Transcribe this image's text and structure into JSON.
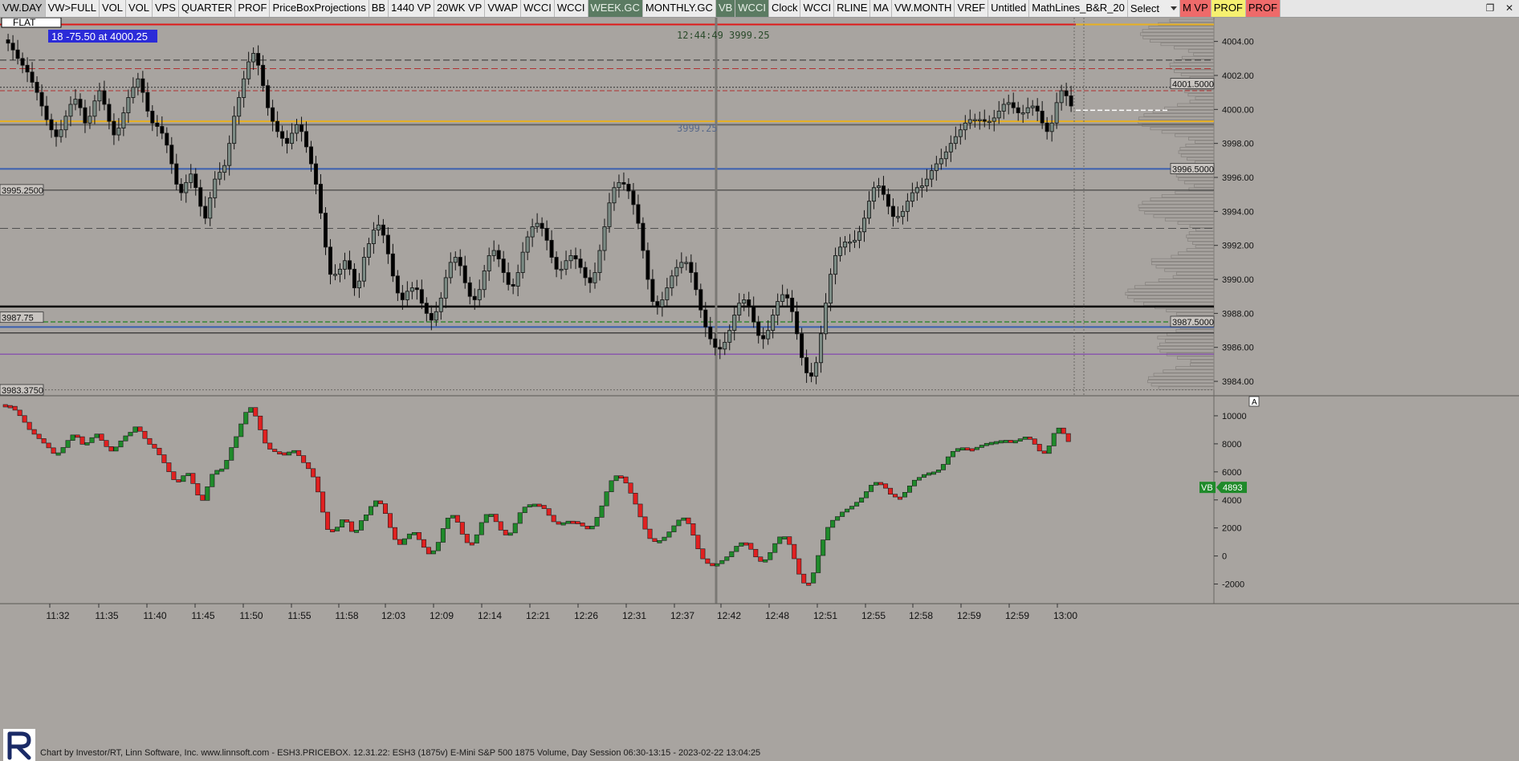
{
  "toolbar": {
    "buttons": [
      {
        "label": "VW.DAY",
        "style": "active"
      },
      {
        "label": "VW>FULL",
        "style": ""
      },
      {
        "label": "VOL",
        "style": ""
      },
      {
        "label": "VOL",
        "style": ""
      },
      {
        "label": "VPS",
        "style": ""
      },
      {
        "label": "QUARTER",
        "style": ""
      },
      {
        "label": "PROF",
        "style": ""
      },
      {
        "label": "PriceBoxProjections",
        "style": ""
      },
      {
        "label": "BB",
        "style": ""
      },
      {
        "label": "1440 VP",
        "style": ""
      },
      {
        "label": "20WK VP",
        "style": ""
      },
      {
        "label": "VWAP",
        "style": ""
      },
      {
        "label": "WCCI",
        "style": ""
      },
      {
        "label": "WCCI",
        "style": ""
      },
      {
        "label": "WEEK.GC",
        "style": "green"
      },
      {
        "label": "MONTHLY.GC",
        "style": ""
      },
      {
        "label": "VB",
        "style": "green"
      },
      {
        "label": "WCCI",
        "style": "green"
      },
      {
        "label": "Clock",
        "style": ""
      },
      {
        "label": "WCCI",
        "style": ""
      },
      {
        "label": "RLINE",
        "style": ""
      },
      {
        "label": "MA",
        "style": ""
      },
      {
        "label": "VW.MONTH",
        "style": ""
      },
      {
        "label": "VREF",
        "style": ""
      },
      {
        "label": "Untitled",
        "style": ""
      },
      {
        "label": "MathLines_B&R_20",
        "style": ""
      },
      {
        "label": "M VP",
        "style": "red"
      },
      {
        "label": "PROF",
        "style": "yellow"
      },
      {
        "label": "PROF",
        "style": "red"
      }
    ],
    "select_label": "Select"
  },
  "window_controls": {
    "restore": "❐",
    "close": "✕"
  },
  "colors": {
    "background": "#a8a4a0",
    "candle_up": "#7b8b84",
    "candle_down": "#000000",
    "bar_up": "#1f8a2a",
    "bar_down": "#e02020",
    "red_line": "#e01818",
    "gold_line": "#e8b020",
    "blue_line": "#3a5fb0",
    "purple_line": "#8040b0",
    "green_dash": "#208020"
  },
  "price_panel": {
    "status_label": "FLAT",
    "position_box": "18  -75.50 at 4000.25",
    "time_price_label": "12:44:49  3999.25",
    "mid_price_label": "3999.25",
    "y_labels": [
      "4004.00",
      "4002.00",
      "4000.00",
      "3998.00",
      "3996.00",
      "3994.00",
      "3992.00",
      "3990.00",
      "3988.00",
      "3986.00",
      "3984.00"
    ],
    "y_values": [
      4004,
      4002,
      4000,
      3998,
      3996,
      3994,
      3992,
      3990,
      3988,
      3986,
      3984
    ],
    "right_tags": [
      {
        "text": "4001.5000",
        "price": 4001.5
      },
      {
        "text": "3996.5000",
        "price": 3996.5
      },
      {
        "text": "3987.5000",
        "price": 3987.5
      }
    ],
    "left_tags": [
      {
        "text": "3995.2500",
        "price": 3995.25
      },
      {
        "text": "3987.75",
        "price": 3987.75
      },
      {
        "text": "3983.3750",
        "price": 3983.375
      }
    ]
  },
  "volume_panel": {
    "y_labels": [
      "10000",
      "8000",
      "6000",
      "4000",
      "2000",
      "0",
      "-2000"
    ],
    "y_values": [
      10000,
      8000,
      6000,
      4000,
      2000,
      0,
      -2000
    ],
    "vb_label": "VB",
    "vb_value": "4893",
    "corner_label": "A"
  },
  "time_axis": [
    "11:32",
    "11:35",
    "11:40",
    "11:45",
    "11:50",
    "11:55",
    "11:58",
    "12:03",
    "12:09",
    "12:14",
    "12:21",
    "12:26",
    "12:31",
    "12:37",
    "12:42",
    "12:48",
    "12:51",
    "12:55",
    "12:58",
    "12:59",
    "12:59",
    "13:00"
  ],
  "footer": "Chart by Investor/RT, Linn Software, Inc. www.linnsoft.com - ESH3.PRICEBOX.  12.31.22: ESH3 (1875v) E-Mini S&P 500 1875 Volume, Day Session 06:30-13:15 - 2023-02-22 13:04:25",
  "chart_data": {
    "type": "candlestick",
    "closes": [
      4003.9,
      4003.5,
      4003.0,
      4002.6,
      4002.2,
      4001.6,
      4001.0,
      4000.2,
      3999.4,
      3998.8,
      3998.4,
      3998.8,
      3999.6,
      4000.3,
      4000.6,
      4000.1,
      3999.2,
      3999.6,
      4000.5,
      4001.1,
      4000.3,
      3999.3,
      3998.5,
      3998.9,
      3999.8,
      4000.7,
      4001.3,
      4001.8,
      4001.0,
      3999.9,
      3999.2,
      3999.0,
      3998.6,
      3997.9,
      3996.8,
      3995.6,
      3995.1,
      3995.7,
      3996.2,
      3995.4,
      3994.3,
      3993.6,
      3994.8,
      3995.9,
      3996.3,
      3996.7,
      3998.0,
      3999.6,
      4000.7,
      4001.8,
      4002.8,
      4003.3,
      4002.6,
      4001.4,
      4000.1,
      3999.3,
      3998.7,
      3998.3,
      3998.0,
      3998.6,
      3999.1,
      3998.7,
      3997.8,
      3996.8,
      3995.6,
      3993.9,
      3991.9,
      3990.3,
      3990.3,
      3990.6,
      3991.1,
      3990.6,
      3989.5,
      3989.9,
      3991.3,
      3992.1,
      3992.9,
      3993.2,
      3992.6,
      3991.5,
      3990.2,
      3989.2,
      3988.8,
      3989.3,
      3989.5,
      3989.4,
      3988.6,
      3988.0,
      3987.6,
      3988.1,
      3988.9,
      3990.1,
      3991.0,
      3991.3,
      3990.8,
      3989.8,
      3989.0,
      3988.8,
      3989.4,
      3990.5,
      3991.4,
      3991.7,
      3991.2,
      3990.4,
      3989.7,
      3989.6,
      3990.4,
      3991.6,
      3992.5,
      3993.1,
      3993.3,
      3993.0,
      3992.3,
      3991.3,
      3990.6,
      3990.6,
      3991.1,
      3991.4,
      3991.2,
      3990.7,
      3990.1,
      3989.8,
      3990.4,
      3991.7,
      3993.1,
      3994.5,
      3995.4,
      3995.7,
      3995.6,
      3995.2,
      3994.4,
      3993.3,
      3991.7,
      3990.0,
      3988.7,
      3988.4,
      3988.8,
      3989.5,
      3990.2,
      3990.7,
      3991.0,
      3991.0,
      3990.4,
      3989.4,
      3988.2,
      3987.2,
      3986.5,
      3986.0,
      3985.9,
      3986.3,
      3987.0,
      3987.9,
      3988.6,
      3988.8,
      3988.4,
      3987.5,
      3986.7,
      3986.5,
      3987.0,
      3987.9,
      3988.7,
      3989.1,
      3988.9,
      3988.1,
      3986.8,
      3985.4,
      3984.5,
      3984.3,
      3985.1,
      3986.8,
      3988.6,
      3990.3,
      3991.4,
      3991.9,
      3992.2,
      3992.2,
      3992.3,
      3992.8,
      3993.6,
      3994.6,
      3995.4,
      3995.5,
      3995.0,
      3994.3,
      3993.7,
      3993.7,
      3994.0,
      3994.6,
      3995.1,
      3995.4,
      3995.5,
      3995.9,
      3996.4,
      3996.8,
      3997.1,
      3997.5,
      3998.0,
      3998.4,
      3998.8,
      3999.2,
      3999.4,
      3999.4,
      3999.4,
      3999.3,
      3999.3,
      3999.5,
      3999.9,
      4000.3,
      4000.4,
      4000.1,
      3999.8,
      3999.8,
      4000.1,
      4000.2,
      3999.9,
      3999.2,
      3998.7,
      3999.2,
      4000.4,
      4001.1,
      4000.8,
      4000.2
    ]
  }
}
